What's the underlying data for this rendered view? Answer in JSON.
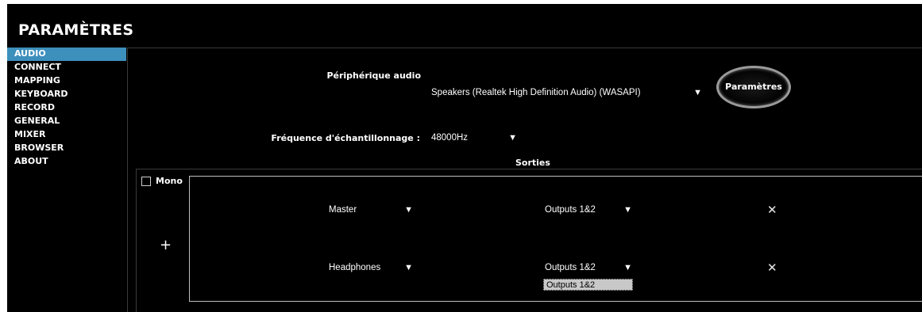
{
  "title": "PARAMÈTRES",
  "sidebar": {
    "items": [
      {
        "label": "AUDIO"
      },
      {
        "label": "CONNECT"
      },
      {
        "label": "MAPPING"
      },
      {
        "label": "KEYBOARD"
      },
      {
        "label": "RECORD"
      },
      {
        "label": "GENERAL"
      },
      {
        "label": "MIXER"
      },
      {
        "label": "BROWSER"
      },
      {
        "label": "ABOUT"
      }
    ],
    "active": "AUDIO"
  },
  "audio": {
    "device_label": "Périphérique audio",
    "device_value": "Speakers (Realtek High Definition Audio) (WASAPI)",
    "params_button": "Paramètres",
    "rate_label": "Fréquence d'échantillonnage :",
    "rate_value": "48000Hz",
    "outputs_label": "Sorties",
    "mono_label": "Mono",
    "add_symbol": "+",
    "remove_symbol": "✕",
    "arrow": "▼",
    "routes": [
      {
        "source": "Master",
        "output": "Outputs 1&2"
      },
      {
        "source": "Headphones",
        "output": "Outputs 1&2"
      }
    ],
    "open_dropdown_option": "Outputs 1&2"
  },
  "colors": {
    "background": "#000000",
    "active_tab": "#3d8fbc",
    "dropdown_option_bg": "#c8c8c8"
  }
}
